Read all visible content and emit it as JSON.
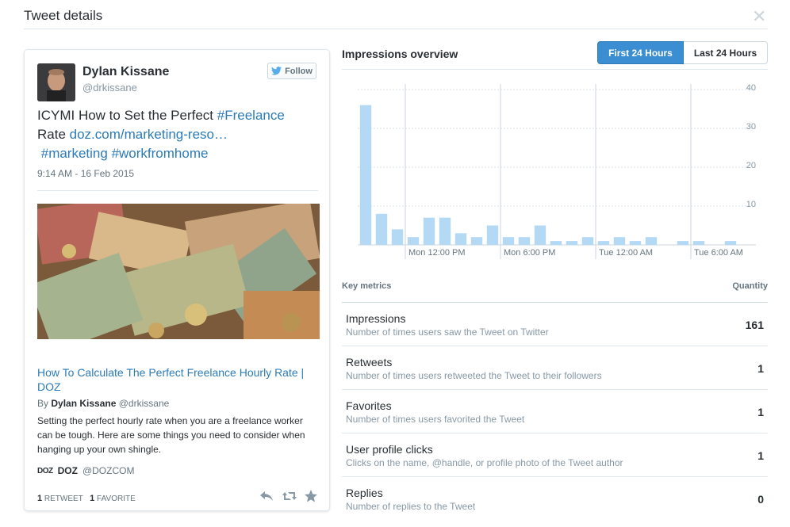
{
  "modal": {
    "title": "Tweet details"
  },
  "tweet": {
    "author_name": "Dylan Kissane",
    "author_handle": "@drkissane",
    "follow_label": "Follow",
    "text_prefix": "ICYMI How to Set the Perfect ",
    "hashtag1": "#Freelance",
    "text_mid": " Rate ",
    "link": "doz.com/marketing-reso…",
    "hashtag2": "#marketing",
    "hashtag3": "#workfromhome",
    "timestamp": "9:14 AM - 16 Feb 2015",
    "card": {
      "title": "How To Calculate The Perfect Freelance Hourly Rate | DOZ",
      "byline_prefix": "By",
      "byline_name": "Dylan Kissane",
      "byline_handle": "@drkissane",
      "summary": "Setting the perfect hourly rate when you are a freelance worker can be tough. Here are some things you need to consider when hanging up your own shingle.",
      "site_logo": "DOZ",
      "site_name": "DOZ",
      "site_handle": "@DOZCOM"
    },
    "retweets_count": "1",
    "retweets_label": "RETWEET",
    "favorites_count": "1",
    "favorites_label": "FAVORITE"
  },
  "impressions": {
    "title": "Impressions overview",
    "toggle": {
      "first": "First 24 Hours",
      "last": "Last 24 Hours",
      "selected": "first"
    }
  },
  "chart_data": {
    "type": "bar",
    "ylim": [
      0,
      40
    ],
    "yticks": [
      "10",
      "20",
      "30",
      "40"
    ],
    "x_tick_labels": [
      "Mon 12:00 PM",
      "Mon 6:00 PM",
      "Tue 12:00 AM",
      "Tue 6:00 AM"
    ],
    "values": [
      36,
      8,
      4,
      2,
      7,
      7,
      3,
      2,
      5,
      2,
      2,
      5,
      1,
      1,
      2,
      1,
      2,
      1,
      2,
      0,
      1,
      1,
      0,
      1
    ],
    "bar_color": "#b3d9f5",
    "grid": true
  },
  "metrics": {
    "header_label": "Key metrics",
    "header_quantity": "Quantity",
    "items": [
      {
        "name": "Impressions",
        "desc": "Number of times users saw the Tweet on Twitter",
        "value": "161"
      },
      {
        "name": "Retweets",
        "desc": "Number of times users retweeted the Tweet to their followers",
        "value": "1"
      },
      {
        "name": "Favorites",
        "desc": "Number of times users favorited the Tweet",
        "value": "1"
      },
      {
        "name": "User profile clicks",
        "desc": "Clicks on the name, @handle, or profile photo of the Tweet author",
        "value": "1"
      },
      {
        "name": "Replies",
        "desc": "Number of replies to the Tweet",
        "value": "0"
      }
    ]
  }
}
